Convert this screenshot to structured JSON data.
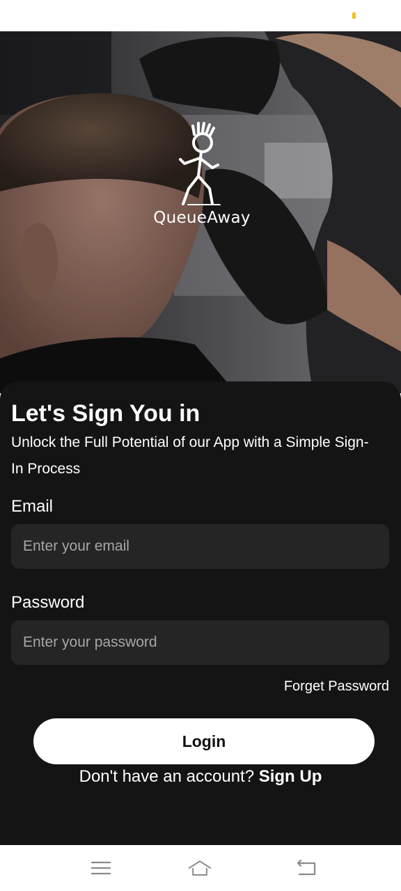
{
  "app": {
    "logo_text": "QueueAway"
  },
  "signin": {
    "title": "Let's Sign You in",
    "subtitle": "Unlock the Full Potential of our App with a Simple Sign-In Process"
  },
  "form": {
    "email_label": "Email",
    "email_placeholder": "Enter your email",
    "email_value": "",
    "password_label": "Password",
    "password_placeholder": "Enter your password",
    "password_value": "",
    "forget_password": "Forget Password",
    "login_label": "Login"
  },
  "signup": {
    "prompt": "Don't have an account? ",
    "link": "Sign Up"
  },
  "nav": {
    "icons": [
      "menu-icon",
      "home-icon",
      "back-icon"
    ]
  },
  "colors": {
    "panel_bg": "#141414",
    "input_bg": "#252525",
    "button_bg": "#ffffff",
    "status_accent": "#f2c01e"
  }
}
